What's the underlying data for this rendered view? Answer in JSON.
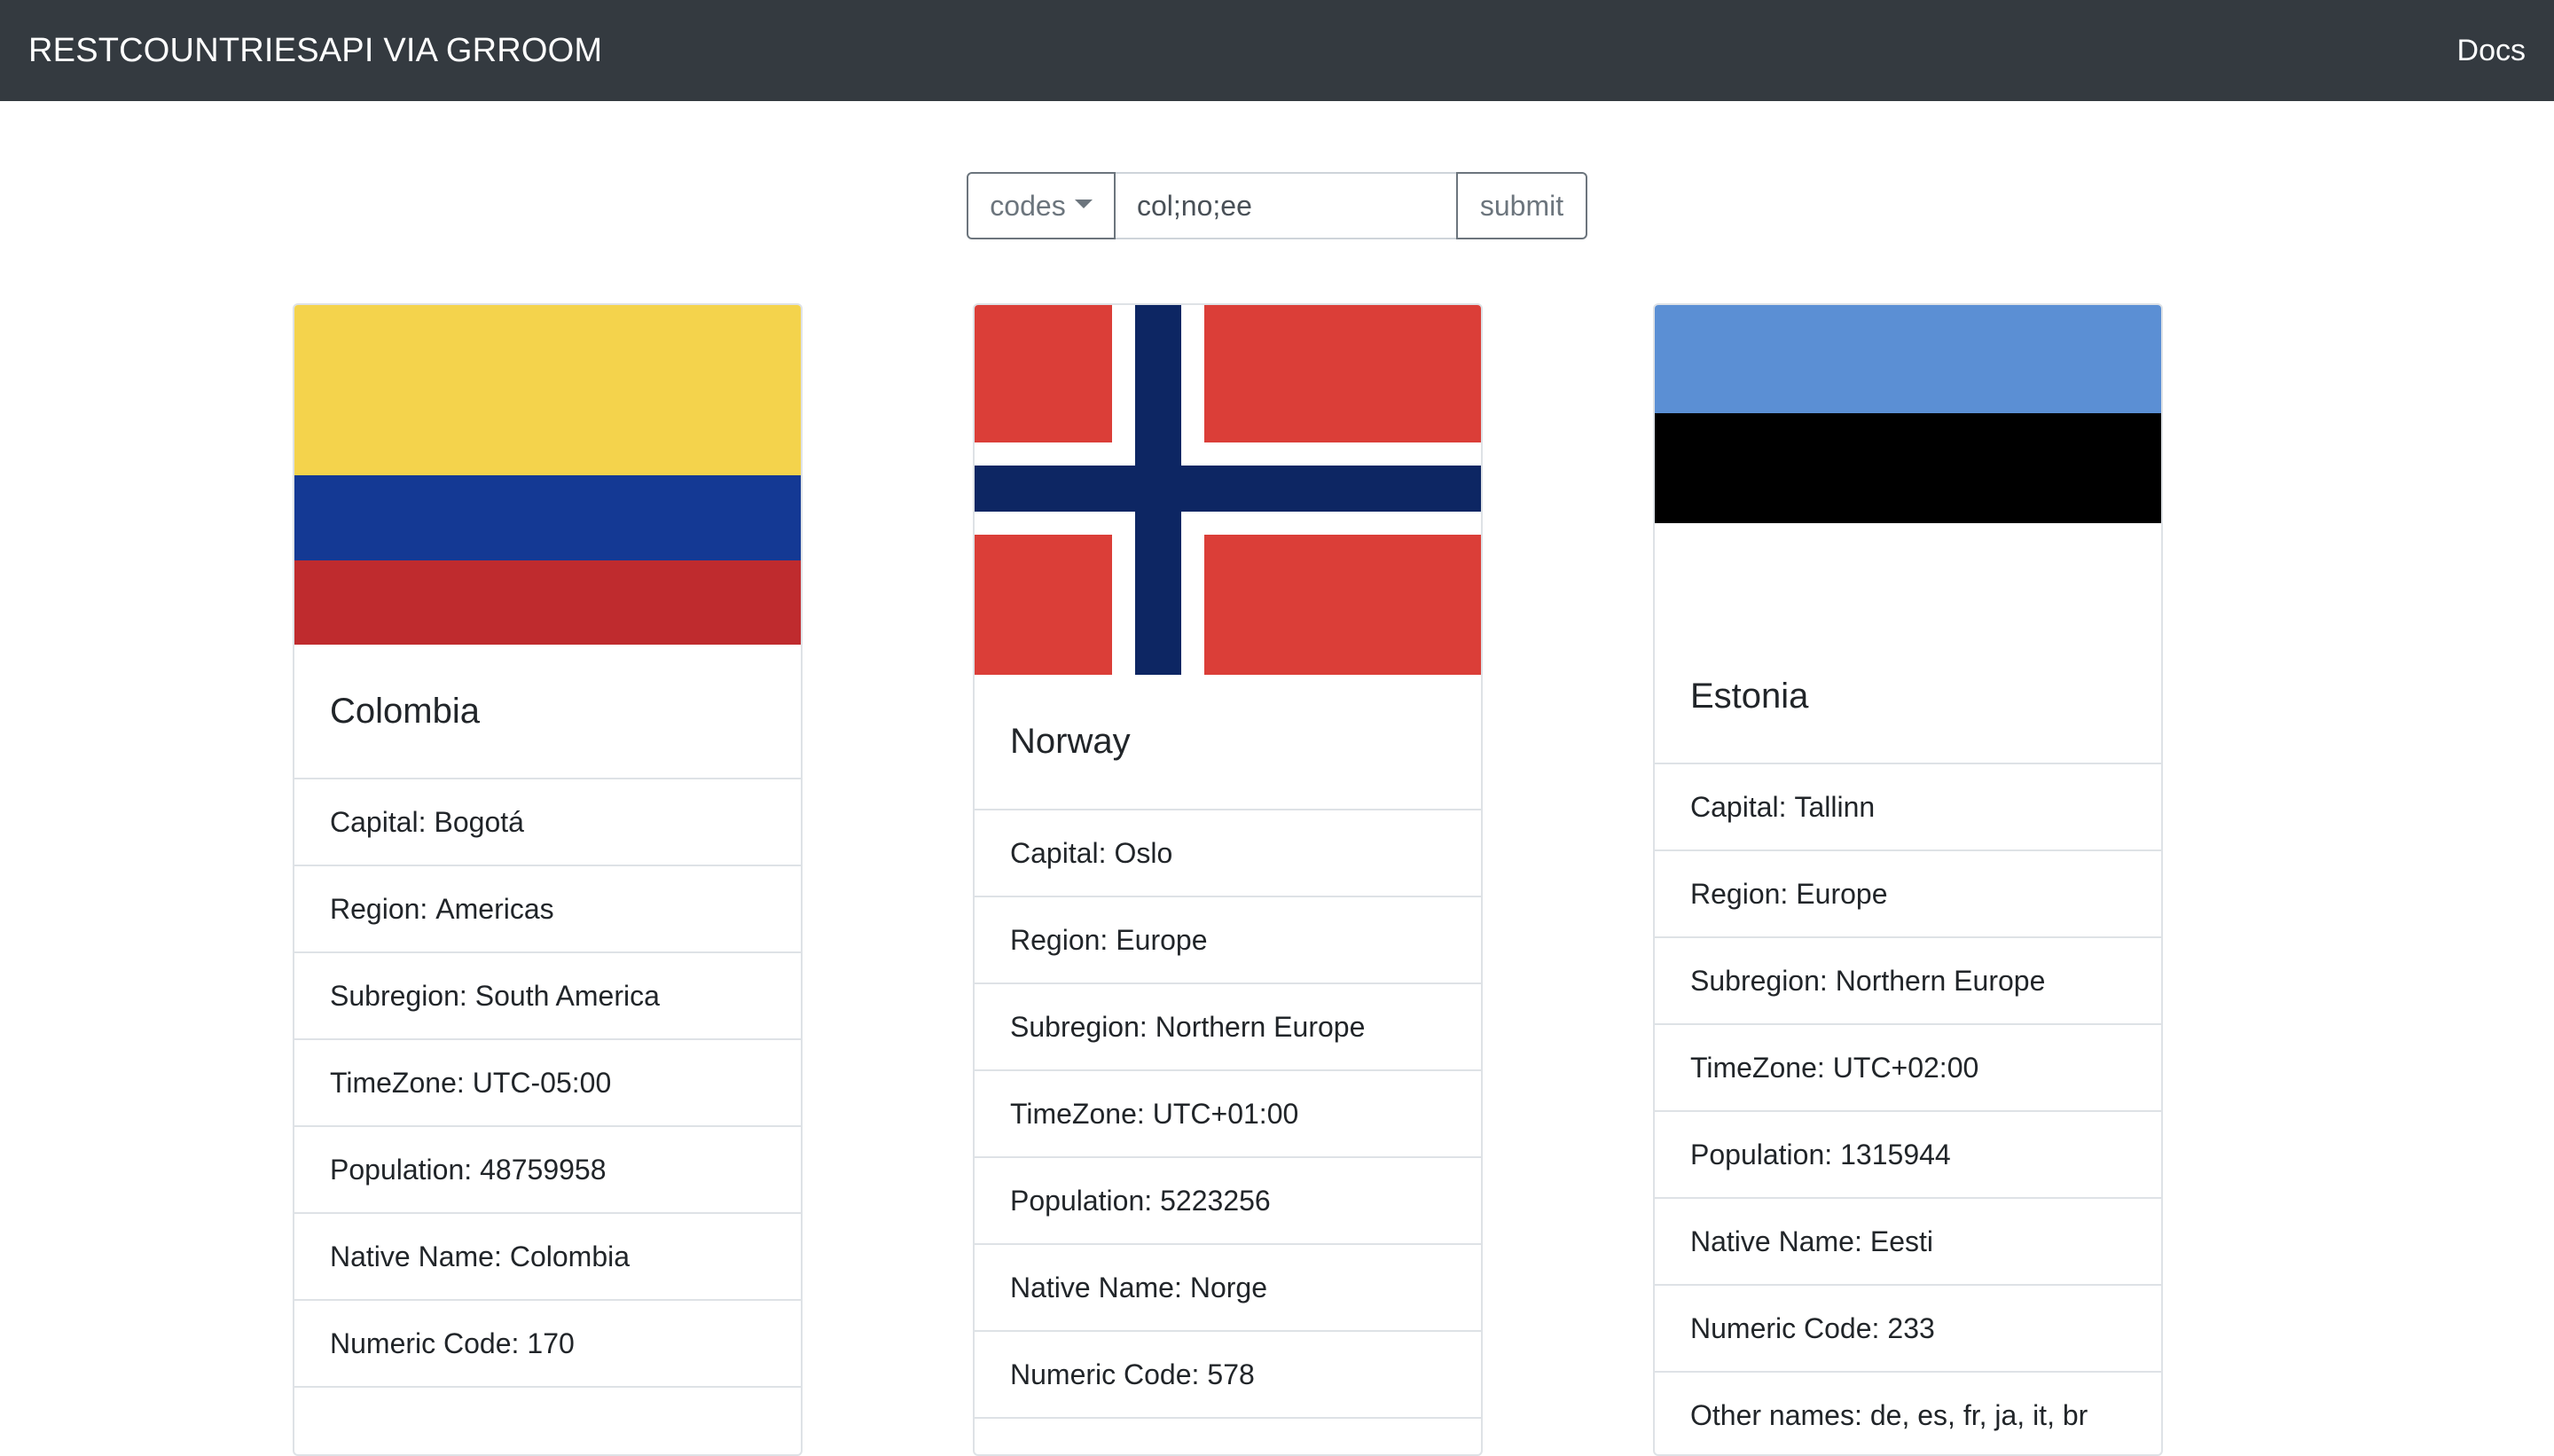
{
  "navbar": {
    "brand": "RESTCOUNTRIESAPI VIA GRROOM",
    "docs_link": "Docs"
  },
  "search": {
    "dropdown_label": "codes",
    "input_value": "col;no;ee",
    "submit_label": "submit"
  },
  "labels": {
    "capital": "Capital:",
    "region": "Region:",
    "subregion": "Subregion:",
    "timezone": "TimeZone:",
    "population": "Population:",
    "native_name": "Native Name:",
    "numeric_code": "Numeric Code:",
    "other_names": "Other names:"
  },
  "colors": {
    "navbar_bg": "#343a40",
    "colombia_yellow": "#f4d34c",
    "colombia_blue": "#143994",
    "colombia_red": "#bf2b2e",
    "norway_red": "#db3e38",
    "norway_blue": "#0d2663",
    "estonia_blue": "#5b8fd4",
    "estonia_black": "#000000",
    "estonia_white": "#ffffff"
  },
  "countries": [
    {
      "name": "Colombia",
      "flag": "colombia-flag",
      "capital": "Bogotá",
      "region": "Americas",
      "subregion": "South America",
      "timezone": "UTC-05:00",
      "population": "48759958",
      "native_name": "Colombia",
      "numeric_code": "170"
    },
    {
      "name": "Norway",
      "flag": "norway-flag",
      "capital": "Oslo",
      "region": "Europe",
      "subregion": "Northern Europe",
      "timezone": "UTC+01:00",
      "population": "5223256",
      "native_name": "Norge",
      "numeric_code": "578"
    },
    {
      "name": "Estonia",
      "flag": "estonia-flag",
      "capital": "Tallinn",
      "region": "Europe",
      "subregion": "Northern Europe",
      "timezone": "UTC+02:00",
      "population": "1315944",
      "native_name": "Eesti",
      "numeric_code": "233",
      "other_names": "de, es, fr, ja, it, br"
    }
  ]
}
